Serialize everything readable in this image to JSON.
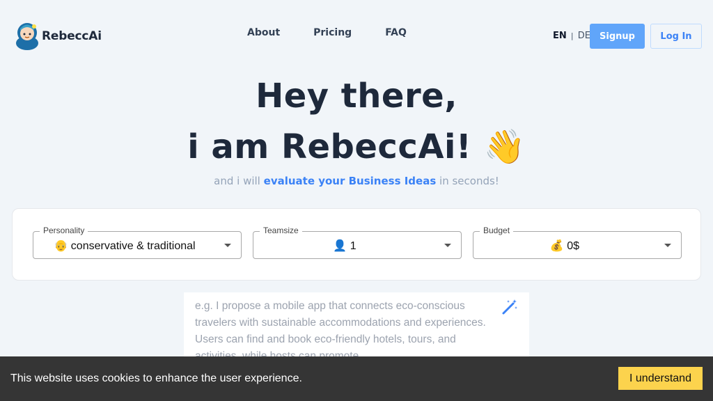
{
  "brand": {
    "name": "RebeccAi"
  },
  "nav": {
    "items": [
      "About",
      "Pricing",
      "FAQ"
    ]
  },
  "lang": {
    "active": "EN",
    "separator": "|",
    "other": "DE"
  },
  "auth": {
    "signup": "Signup",
    "login": "Log In"
  },
  "hero": {
    "line1": "Hey there,",
    "line2": "i am RebeccAi! 👋",
    "sub_pre": "and i will",
    "sub_highlight": "evaluate your Business Ideas",
    "sub_post": "in seconds!"
  },
  "options": {
    "personality": {
      "label": "Personality",
      "value": "👴 conservative & traditional"
    },
    "teamsize": {
      "label": "Teamsize",
      "value": "👤 1"
    },
    "budget": {
      "label": "Budget",
      "value": "💰 0$"
    }
  },
  "idea": {
    "placeholder": "e.g. I propose a mobile app that connects eco-conscious travelers with sustainable accommodations and experiences. Users can find and book eco-friendly hotels, tours, and activities, while hosts can promote"
  },
  "cookie": {
    "text": "This website uses cookies to enhance the user experience.",
    "button": "I understand"
  },
  "colors": {
    "accent": "#60a5fa",
    "accent_text": "#3b82f6",
    "cookie_button": "#fcd34d"
  },
  "icons": {
    "logo": "robot-avatar-icon",
    "wand": "magic-wand-icon",
    "dropdown": "caret-down-icon"
  }
}
